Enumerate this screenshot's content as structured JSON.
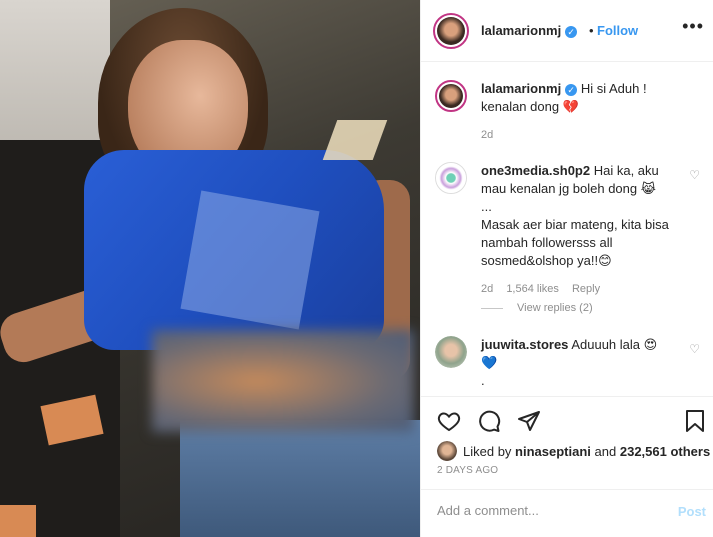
{
  "post_author": {
    "username": "lalamarionmj",
    "verified_icon": "verified-badge-icon",
    "separator": "•",
    "follow_label": "Follow",
    "more_label": "•••"
  },
  "caption": {
    "username": "lalamarionmj",
    "text": "Hi si Aduh ! kenalan dong 💔",
    "time": "2d"
  },
  "comments": [
    {
      "username": "one3media.sh0p2",
      "text": "Hai ka, aku mau kenalan jg boleh dong 😹",
      "text2": "...",
      "text3": "Masak aer biar mateng, kita bisa nambah followersss all sosmed&olshop ya!!😊",
      "time": "2d",
      "likes": "1,564 likes",
      "reply_label": "Reply",
      "view_replies": "View replies (2)"
    },
    {
      "username": "juuwita.stores",
      "text": "Aduuuh lala 😍",
      "text2": "💙",
      "text3": "."
    }
  ],
  "likes": {
    "prefix": "Liked by",
    "user": "ninaseptiani",
    "middle": "and",
    "count": "232,561 others"
  },
  "posted_ago": "2 DAYS AGO",
  "add_comment": {
    "placeholder": "Add a comment...",
    "post_label": "Post"
  },
  "colors": {
    "accent": "#3897f0",
    "story_ring": "#c13584",
    "post_disabled": "#b2dffc"
  }
}
